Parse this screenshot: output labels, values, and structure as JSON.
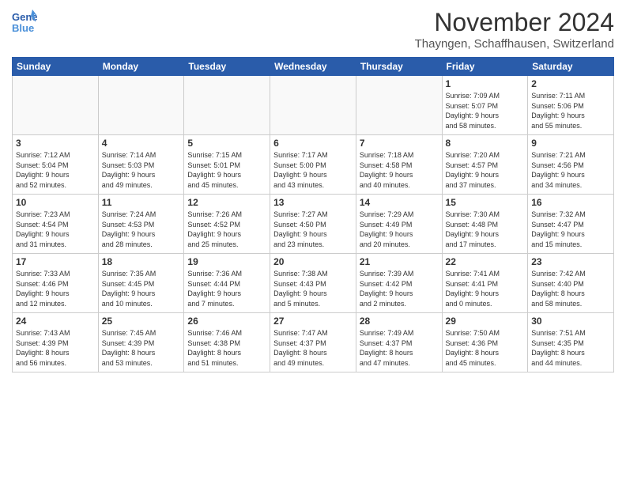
{
  "logo": {
    "line1": "General",
    "line2": "Blue"
  },
  "title": "November 2024",
  "location": "Thayngen, Schaffhausen, Switzerland",
  "weekdays": [
    "Sunday",
    "Monday",
    "Tuesday",
    "Wednesday",
    "Thursday",
    "Friday",
    "Saturday"
  ],
  "weeks": [
    [
      {
        "day": "",
        "info": ""
      },
      {
        "day": "",
        "info": ""
      },
      {
        "day": "",
        "info": ""
      },
      {
        "day": "",
        "info": ""
      },
      {
        "day": "",
        "info": ""
      },
      {
        "day": "1",
        "info": "Sunrise: 7:09 AM\nSunset: 5:07 PM\nDaylight: 9 hours\nand 58 minutes."
      },
      {
        "day": "2",
        "info": "Sunrise: 7:11 AM\nSunset: 5:06 PM\nDaylight: 9 hours\nand 55 minutes."
      }
    ],
    [
      {
        "day": "3",
        "info": "Sunrise: 7:12 AM\nSunset: 5:04 PM\nDaylight: 9 hours\nand 52 minutes."
      },
      {
        "day": "4",
        "info": "Sunrise: 7:14 AM\nSunset: 5:03 PM\nDaylight: 9 hours\nand 49 minutes."
      },
      {
        "day": "5",
        "info": "Sunrise: 7:15 AM\nSunset: 5:01 PM\nDaylight: 9 hours\nand 45 minutes."
      },
      {
        "day": "6",
        "info": "Sunrise: 7:17 AM\nSunset: 5:00 PM\nDaylight: 9 hours\nand 43 minutes."
      },
      {
        "day": "7",
        "info": "Sunrise: 7:18 AM\nSunset: 4:58 PM\nDaylight: 9 hours\nand 40 minutes."
      },
      {
        "day": "8",
        "info": "Sunrise: 7:20 AM\nSunset: 4:57 PM\nDaylight: 9 hours\nand 37 minutes."
      },
      {
        "day": "9",
        "info": "Sunrise: 7:21 AM\nSunset: 4:56 PM\nDaylight: 9 hours\nand 34 minutes."
      }
    ],
    [
      {
        "day": "10",
        "info": "Sunrise: 7:23 AM\nSunset: 4:54 PM\nDaylight: 9 hours\nand 31 minutes."
      },
      {
        "day": "11",
        "info": "Sunrise: 7:24 AM\nSunset: 4:53 PM\nDaylight: 9 hours\nand 28 minutes."
      },
      {
        "day": "12",
        "info": "Sunrise: 7:26 AM\nSunset: 4:52 PM\nDaylight: 9 hours\nand 25 minutes."
      },
      {
        "day": "13",
        "info": "Sunrise: 7:27 AM\nSunset: 4:50 PM\nDaylight: 9 hours\nand 23 minutes."
      },
      {
        "day": "14",
        "info": "Sunrise: 7:29 AM\nSunset: 4:49 PM\nDaylight: 9 hours\nand 20 minutes."
      },
      {
        "day": "15",
        "info": "Sunrise: 7:30 AM\nSunset: 4:48 PM\nDaylight: 9 hours\nand 17 minutes."
      },
      {
        "day": "16",
        "info": "Sunrise: 7:32 AM\nSunset: 4:47 PM\nDaylight: 9 hours\nand 15 minutes."
      }
    ],
    [
      {
        "day": "17",
        "info": "Sunrise: 7:33 AM\nSunset: 4:46 PM\nDaylight: 9 hours\nand 12 minutes."
      },
      {
        "day": "18",
        "info": "Sunrise: 7:35 AM\nSunset: 4:45 PM\nDaylight: 9 hours\nand 10 minutes."
      },
      {
        "day": "19",
        "info": "Sunrise: 7:36 AM\nSunset: 4:44 PM\nDaylight: 9 hours\nand 7 minutes."
      },
      {
        "day": "20",
        "info": "Sunrise: 7:38 AM\nSunset: 4:43 PM\nDaylight: 9 hours\nand 5 minutes."
      },
      {
        "day": "21",
        "info": "Sunrise: 7:39 AM\nSunset: 4:42 PM\nDaylight: 9 hours\nand 2 minutes."
      },
      {
        "day": "22",
        "info": "Sunrise: 7:41 AM\nSunset: 4:41 PM\nDaylight: 9 hours\nand 0 minutes."
      },
      {
        "day": "23",
        "info": "Sunrise: 7:42 AM\nSunset: 4:40 PM\nDaylight: 8 hours\nand 58 minutes."
      }
    ],
    [
      {
        "day": "24",
        "info": "Sunrise: 7:43 AM\nSunset: 4:39 PM\nDaylight: 8 hours\nand 56 minutes."
      },
      {
        "day": "25",
        "info": "Sunrise: 7:45 AM\nSunset: 4:39 PM\nDaylight: 8 hours\nand 53 minutes."
      },
      {
        "day": "26",
        "info": "Sunrise: 7:46 AM\nSunset: 4:38 PM\nDaylight: 8 hours\nand 51 minutes."
      },
      {
        "day": "27",
        "info": "Sunrise: 7:47 AM\nSunset: 4:37 PM\nDaylight: 8 hours\nand 49 minutes."
      },
      {
        "day": "28",
        "info": "Sunrise: 7:49 AM\nSunset: 4:37 PM\nDaylight: 8 hours\nand 47 minutes."
      },
      {
        "day": "29",
        "info": "Sunrise: 7:50 AM\nSunset: 4:36 PM\nDaylight: 8 hours\nand 45 minutes."
      },
      {
        "day": "30",
        "info": "Sunrise: 7:51 AM\nSunset: 4:35 PM\nDaylight: 8 hours\nand 44 minutes."
      }
    ]
  ]
}
